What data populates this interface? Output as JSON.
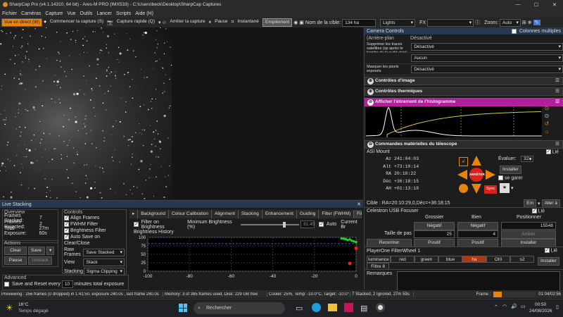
{
  "titlebar": {
    "title": "SharpCap Pro (v4.1.14310, 64 bit) - Ares-M PRO (IMX533) - C:\\Users\\beck\\Desktop\\SharpCap Captures",
    "controls": [
      "—",
      "☐",
      "✕"
    ]
  },
  "menu": [
    "Fichier",
    "Caméras",
    "Capture",
    "Vue",
    "Outils",
    "Lancer",
    "Scripts",
    "Aide (H)"
  ],
  "toolbar": {
    "live": "Vue en direct (W)",
    "start": "Commencer la capture (S)",
    "quick": "Capture rapide (Q)",
    "stop": "Arrêter la capture",
    "pause": "Pause",
    "snapshot": "Instantané",
    "stack": "Empilement",
    "target_label": "Nom de la cible:",
    "target_value": "134 ha",
    "frame_type": "Lights",
    "fx": "FX",
    "zoom_label": "Zoom:",
    "zoom_value": "Auto"
  },
  "live_stacking": {
    "title": "Live Stacking",
    "overview": {
      "title": "Overview",
      "rows": [
        {
          "k": "Frames Stacked:",
          "v": "7"
        },
        {
          "k": "Frames Rejected:",
          "v": "2"
        },
        {
          "k": "Total Exposure:",
          "v": "27m 60s"
        }
      ]
    },
    "actions": {
      "title": "Actions",
      "clear": "Clear",
      "save": "Save",
      "pause": "Pause",
      "unstack": "Unstack"
    },
    "advanced": {
      "title": "Advanced",
      "save_reset": "Save and Reset every",
      "minutes": "10",
      "suffix": "minutes total exposure"
    },
    "controls": {
      "title": "Controls",
      "align": "Align Frames",
      "fwhm": "FWHM Filter",
      "brightness": "Brightness Filter",
      "autosave": "Auto Save on Clear/Close",
      "raw_label": "Raw Frames",
      "raw_value": "Save Stacked",
      "view_label": "View",
      "view_value": "Stack",
      "stacking_label": "Stacking",
      "stacking_value": "Sigma Clipping"
    },
    "tabs": [
      "Background",
      "Colour Calibration",
      "Alignment",
      "Stacking",
      "Enhancement",
      "Guiding",
      "Filter (FWHM)",
      "Filter (Brightn"
    ],
    "filter": {
      "label": "Filter on Brightness",
      "min_label": "Minimum Brightness (%)",
      "min_value": "81.45",
      "auto": "Auto",
      "current": "Current Br"
    },
    "history_title": "Brightness History",
    "chart_data": {
      "type": "line",
      "ylim": [
        0,
        100
      ],
      "xlim": [
        -100,
        0
      ],
      "xticks": [
        -100,
        -80,
        -60,
        -40,
        -20,
        0
      ],
      "yticks": [
        0,
        25,
        50,
        75,
        100
      ],
      "threshold": 81.45,
      "series": [
        {
          "values_x": [
            -7,
            -6,
            -5,
            -4,
            -3,
            -2,
            -1,
            0
          ],
          "values_y": [
            97,
            96,
            95,
            92,
            94,
            90,
            88,
            86
          ]
        }
      ],
      "rejected": [
        {
          "x": -3,
          "y": 23
        },
        {
          "x": 0,
          "y": 68
        }
      ]
    }
  },
  "right": {
    "header_close": "✕",
    "pin": "Colonnes multiples",
    "camera_controls": "Camera Controls",
    "subtitle_a": "(Arrière-plan",
    "subtitle_b": "Désactivé",
    "rows": [
      {
        "label": "Supprimer les traces satellites (sp après le bombe de le nuité clair)",
        "value": "Désactivé"
      },
      {
        "label": "",
        "value": "Aucun"
      },
      {
        "label": "Masquer les pixels exposés",
        "value": "Désactivé"
      }
    ],
    "image_controls": "Contrôles d'image",
    "thermal": "Contrôles thermiques",
    "histogram": "Afficher l'étirement de l'histogramme",
    "scope": "Commandes matérielles du télescope",
    "mount": {
      "name": "ASI Mount",
      "linked": "Lié",
      "az_l": "Az",
      "az": "241:04:03",
      "alt_l": "Alt",
      "alt": "+73:10:14",
      "ra_l": "RA",
      "ra": "20:10:22",
      "dec_l": "Déc",
      "dec": "+36:18:15",
      "ah_l": "AH",
      "ah": "+01:13:18",
      "eval_label": "Évaluer:",
      "eval_value": "32x",
      "install": "Installer",
      "guide": "se garer",
      "stop": "ARRÊTER",
      "sync": "Sync",
      "target": "Cible : RA=20:10:29,0,Déc=+36:18:15",
      "en": "Em",
      "goto": "Aller à"
    },
    "focuser": {
      "name": "Celestron USB Focuser",
      "linked": "Lié",
      "gross": "Grossier",
      "fine": "Bien",
      "position": "Positionner",
      "neg": "Négatif",
      "pos": "Positif",
      "step_label": "Taille de pas",
      "step_coarse": "25",
      "step_fine": "4",
      "pos_value": "15548",
      "stop": "Arrêter",
      "recenter": "Recentrer",
      "install": "Installer"
    },
    "filterwheel": {
      "name": "PlayerOne FilterWheel 1",
      "linked": "Lié",
      "filters": [
        "luminance",
        "red",
        "green",
        "blue",
        "ha",
        "OIII",
        "s2"
      ],
      "active": "ha",
      "slot": "Filtre 8",
      "install": "Installer"
    },
    "remarks": "Remarques"
  },
  "status": {
    "a": "Previewing : 256 frames (0 dropped) in 1:41:50, exposure 240.0s , last frame 240.0s",
    "b": "Memory: 3 of 385 frames used, Disk: 229 GB free",
    "c": "Cooler: 25%, Temp: -10.0°C, Target: -10.0°",
    "d": "7 Stacked, 2 Ignored, 27m 59s",
    "frame": "Frame :",
    "time": "01:04/02:56"
  },
  "taskbar": {
    "temp": "16°C",
    "weather": "Temps dégagé",
    "search": "Rechercher",
    "clock": "00:50",
    "date": "24/08/2026"
  },
  "colors": {
    "accent": "#c91ea8",
    "orange": "#e8840e",
    "link": "#8fd0ff"
  }
}
